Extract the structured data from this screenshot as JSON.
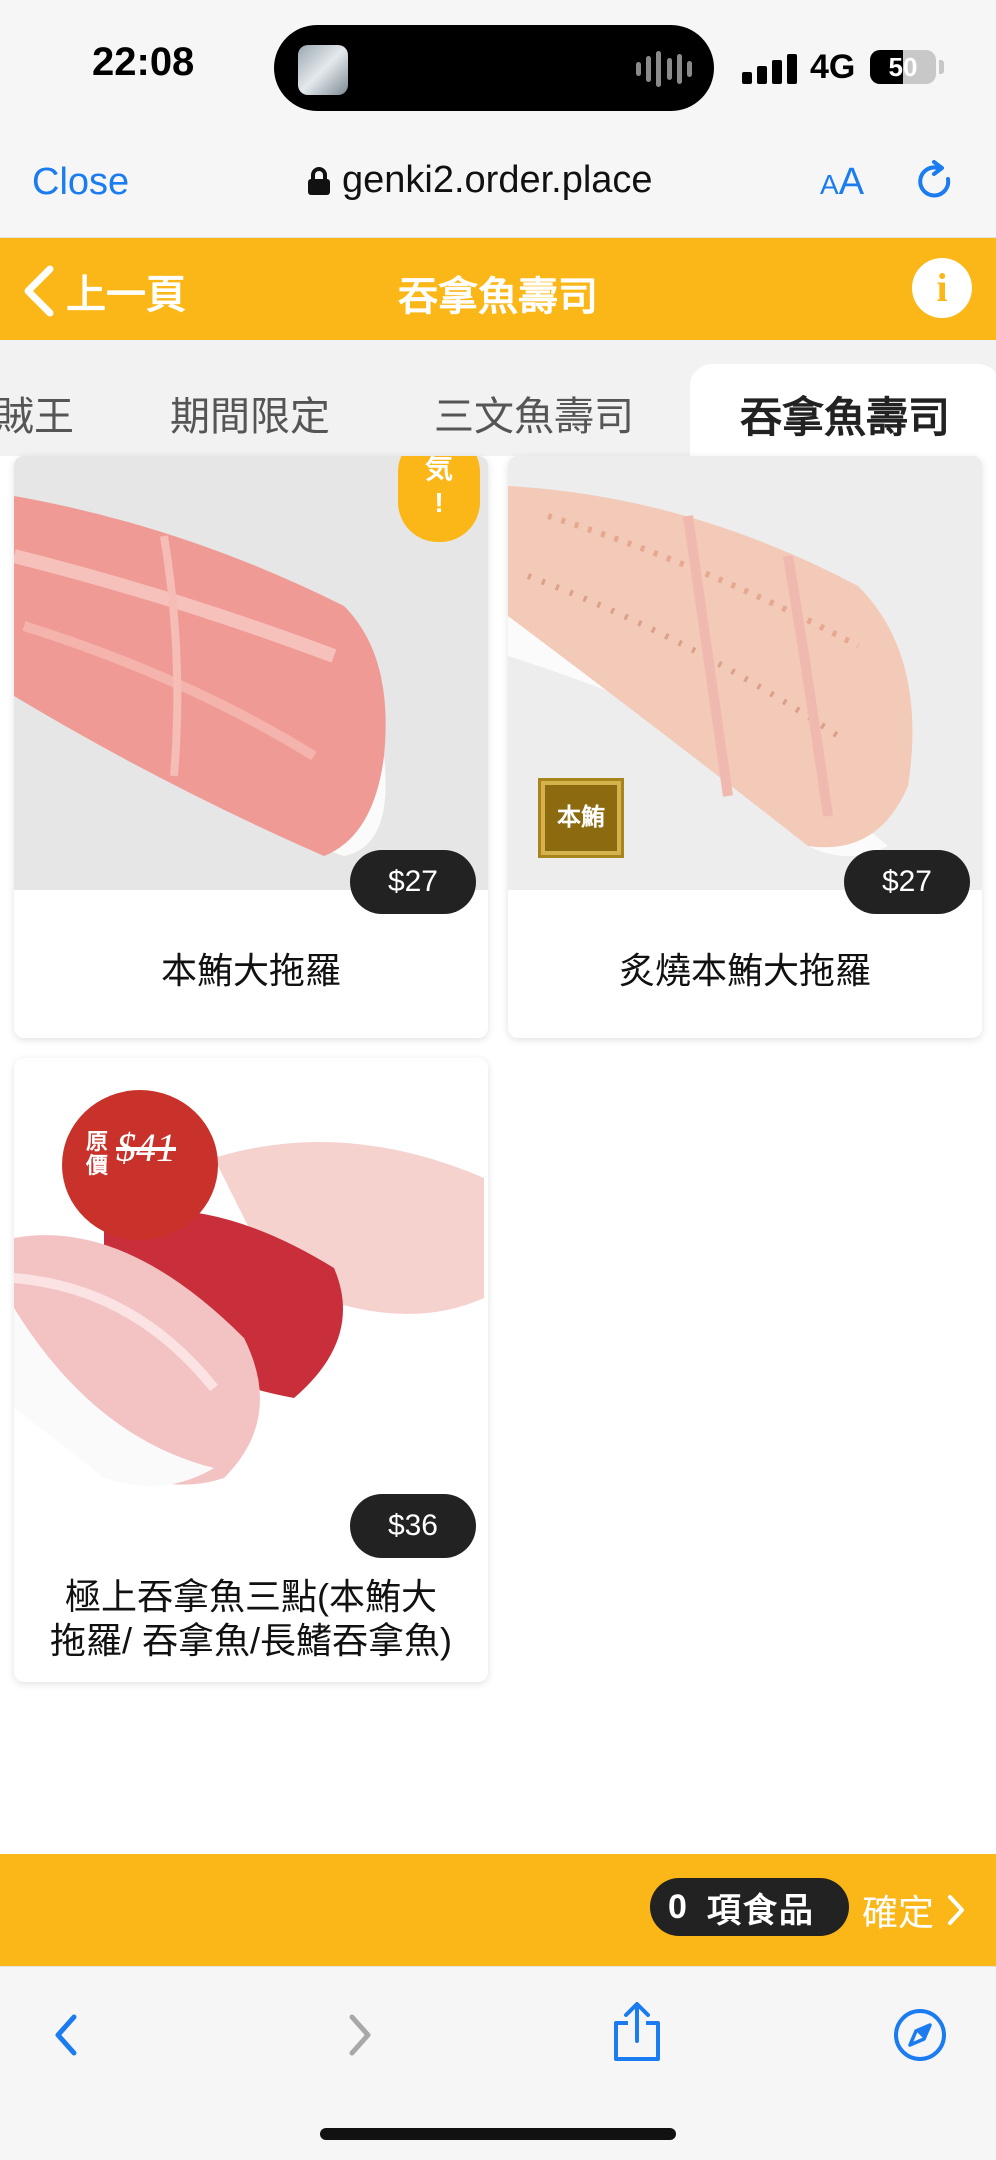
{
  "status_bar": {
    "time": "22:08",
    "network": "4G",
    "battery_level": 50,
    "battery_text": "50"
  },
  "browser": {
    "close_label": "Close",
    "url": "genki2.order.place",
    "text_size_small": "A",
    "text_size_large": "A"
  },
  "header": {
    "back_label": "上一頁",
    "title": "吞拿魚壽司",
    "info_icon_glyph": "i"
  },
  "tabs": [
    {
      "label": "賊王",
      "active": false
    },
    {
      "label": "期間限定",
      "active": false
    },
    {
      "label": "三文魚壽司",
      "active": false
    },
    {
      "label": "吞拿魚壽司",
      "active": true
    }
  ],
  "products": [
    {
      "name_lines": [
        "本鮪大拖羅"
      ],
      "price": "$27",
      "badge_text": "気",
      "badge_mark": "!"
    },
    {
      "name_lines": [
        "炙燒本鮪大拖羅"
      ],
      "price": "$27",
      "badge_text": "本鮪"
    },
    {
      "name_lines": [
        "極上吞拿魚三點(本鮪大",
        "拖羅/ 吞拿魚/長鰭吞拿魚)"
      ],
      "price": "$36",
      "original_label": "原價",
      "original_price": "$41"
    }
  ],
  "order_bar": {
    "item_count": "0",
    "items_label": "項食品",
    "confirm_label": "確定"
  },
  "colors": {
    "brand_yellow": "#fbb617",
    "link_blue": "#1a7cf0",
    "pill_dark": "#222222",
    "sale_red": "#c8322a"
  },
  "icons": {
    "browser_back": "chevron-left-icon",
    "browser_forward": "chevron-right-icon",
    "share": "share-icon",
    "safari": "compass-icon",
    "reload": "reload-icon",
    "lock": "lock-icon"
  }
}
